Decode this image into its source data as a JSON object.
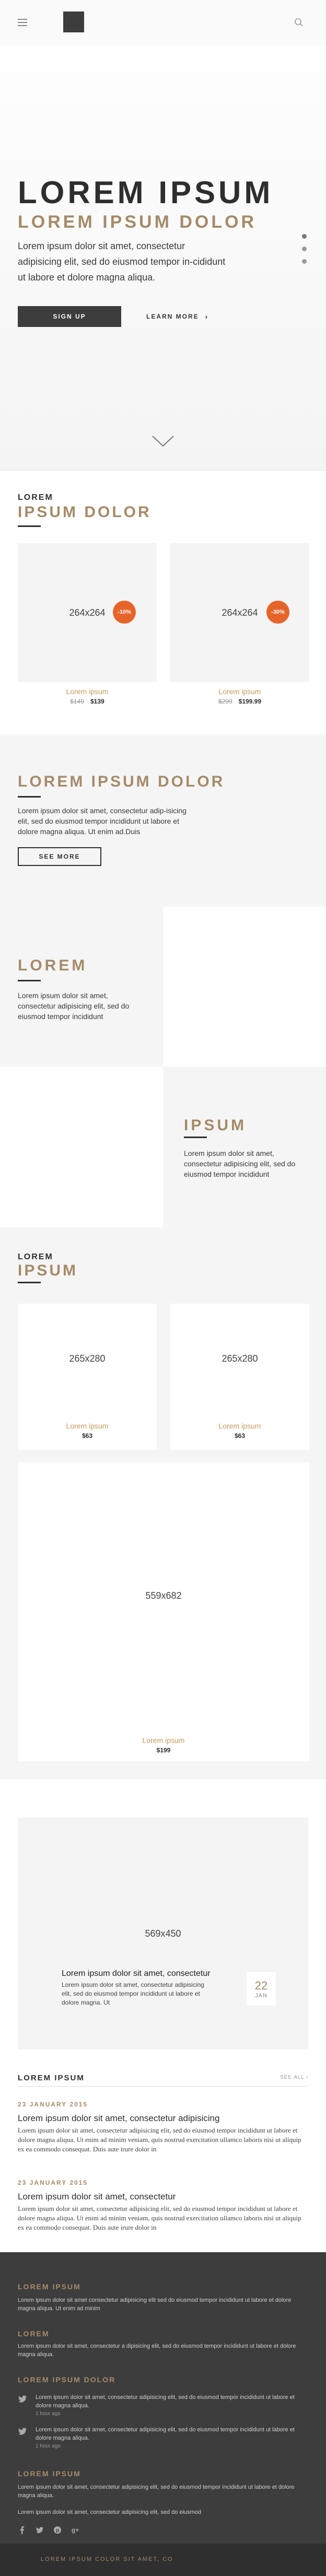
{
  "header": {
    "menu_icon": "hamburger-menu-icon",
    "logo_icon": "logo-square",
    "search_icon": "search-icon"
  },
  "hero": {
    "title": "LOREM IPSUM",
    "subtitle": "LOREM IPSUM DOLOR",
    "text": "Lorem ipsum dolor sit amet, consectetur adipisicing elit, sed do eiusmod tempor in-cididunt ut labore et dolore magna aliqua.",
    "signup_label": "SIGN UP",
    "learn_more_label": "LEARN MORE",
    "learn_more_arrow": "›",
    "slide_count": 3,
    "active_slide": 1
  },
  "products": {
    "kicker": "LOREM",
    "heading": "IPSUM DOLOR",
    "items": [
      {
        "image_label": "264x264",
        "badge": "-10%",
        "name": "Lorem ipsum",
        "old_price": "$149",
        "price": "$139"
      },
      {
        "image_label": "264x264",
        "badge": "-30%",
        "name": "Lorem ipsum",
        "old_price": "$299",
        "price": "$199.99"
      }
    ]
  },
  "cta": {
    "title": "LOREM IPSUM DOLOR",
    "text": "Lorem ipsum dolor sit amet, consectetur adip-isicing elit, sed do eiusmod tempor incididunt ut labore et dolore magna aliqua. Ut enim ad.Duis",
    "button_label": "SEE MORE"
  },
  "split_left": {
    "title": "LOREM",
    "text": "Lorem ipsum dolor sit amet, consectetur adipisicing elit, sed do eiusmod tempor incididunt"
  },
  "split_right": {
    "title": "IPSUM",
    "text": "Lorem ipsum dolor sit amet, consectetur adipisicing elit, sed do eiusmod tempor incididunt"
  },
  "collection": {
    "kicker": "LOREM",
    "heading": "IPSUM",
    "items": [
      {
        "image_label": "265x280",
        "name": "Lorem ipsum",
        "price": "$63"
      },
      {
        "image_label": "265x280",
        "name": "Lorem ipsum",
        "price": "$63"
      }
    ],
    "featured": {
      "image_label": "559x682",
      "name": "Lorem ipsum",
      "price": "$199"
    }
  },
  "feature": {
    "image_label": "569x450",
    "title": "Lorem ipsum dolor sit amet, consectetur",
    "text": "Lorem ipsum dolor sit amet, consectetur adipisicing elit, sed do eiusmod tempor incididunt ut labore et dolore magna. Ut",
    "date_day": "22",
    "date_month": "JAN"
  },
  "news": {
    "heading": "LOREM IPSUM",
    "see_all": "SEE ALL ›",
    "items": [
      {
        "date": "23 JANUARY 2015",
        "title": "Lorem ipsum dolor sit amet, consectetur adipisicing",
        "body": "Lorem ipsum dolor sit amet, consectetur adipisicing elit, sed do eiusmod tempor incididunt ut labore et dolore magna aliqua. Ut enim ad minim veniam, quis nostrud exercitation ullamco laboris nisi ut aliquip ex ea commodo consequat. Duis aute irure dolor in"
      },
      {
        "date": "23 JANUARY 2015",
        "title": "Lorem ipsum dolor sit amet, consectetur",
        "body": "Lorem ipsum dolor sit amet, consectetur adipisicing elit, sed do eiusmod tempor incididunt ut labore et dolore magna aliqua. Ut enim ad minim veniam, quis nostrud exercitation ullamco laboris nisi ut aliquip ex ea commodo consequat. Duis aute irure dolor in"
      }
    ]
  },
  "footer": {
    "block1_title": "LOREM IPSUM",
    "block1_text": "Lorem ipsum dolor sit amet consectetur adipisicing elit sed do eiusmod tempor incididunt ut labore et dolore magna aliqua. Ut enim ad minim",
    "block2_title": "LOREM",
    "block2_text": "Lorem ipsum dolor sit amet, consectetur a dipisicing elit, sed do eiusmod tempor incididunt ut labore et dolore magna aliqua.",
    "block3_title": "LOREM IPSUM DOLOR",
    "tweets": [
      {
        "text": "Lorem ipsum dolor sit amet, consectetur adipisicing elit, sed do eiusmod tempor incididunt ut labore et dolore magna aliqua.",
        "time": "1 hour ago"
      },
      {
        "text": "Lorem ipsum dolor sit amet, consectetur adipisicing elit, sed do eiusmod tempor incididunt ut labore et dolore magna aliqua.",
        "time": "1 hour ago"
      }
    ],
    "block4_title": "LOREM IPSUM",
    "block4_text1": "Lorem ipsum dolor sit amet, consectetur adipisicing elit, sed do eiusmod tempor incididunt ut labore et dolore magna aliqua.",
    "block4_text2": "Lorem ipsum dolor sit amet, consectetur adipisicing elit, sed do eiusmod",
    "social_icons": [
      "facebook-icon",
      "twitter-icon",
      "pinterest-icon",
      "google-plus-icon"
    ],
    "copyright": "LOREM IPSUM COLOR SIT AMET, CO"
  },
  "colors": {
    "accent": "#a58b69",
    "badge": "#e6642a",
    "dark": "#3d3d3d",
    "footer_bg": "#3d3d3d"
  }
}
